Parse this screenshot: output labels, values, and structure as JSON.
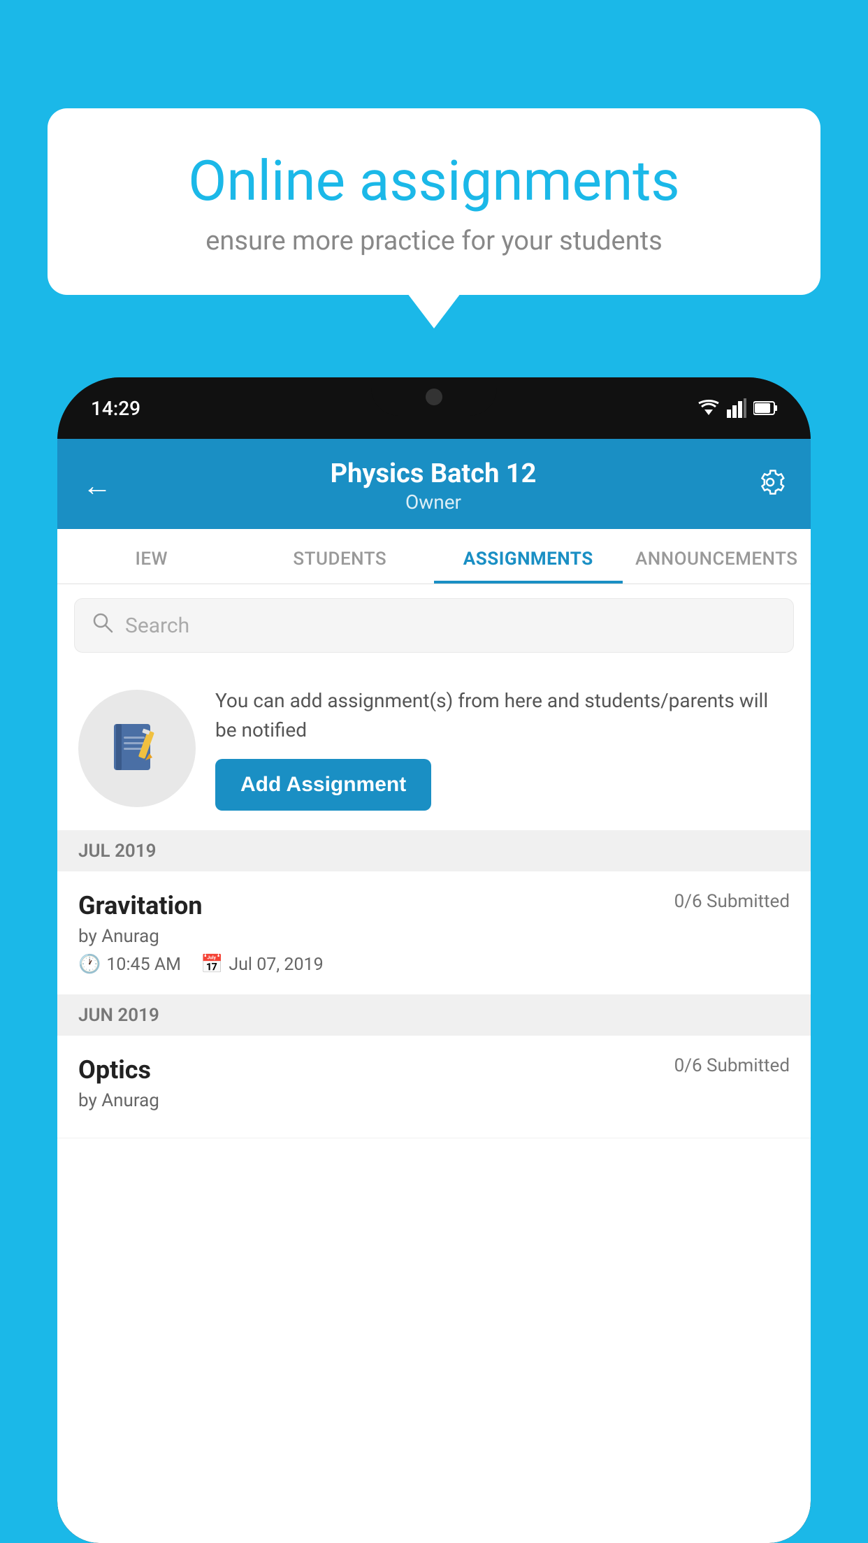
{
  "background_color": "#1bb8e8",
  "speech_bubble": {
    "title": "Online assignments",
    "subtitle": "ensure more practice for your students"
  },
  "phone": {
    "status_bar": {
      "time": "14:29",
      "icons": [
        "wifi",
        "signal",
        "battery"
      ]
    },
    "header": {
      "title": "Physics Batch 12",
      "subtitle": "Owner",
      "back_label": "←",
      "settings_label": "⚙"
    },
    "tabs": [
      {
        "label": "IEW",
        "active": false
      },
      {
        "label": "STUDENTS",
        "active": false
      },
      {
        "label": "ASSIGNMENTS",
        "active": true
      },
      {
        "label": "ANNOUNCEMENTS",
        "active": false
      }
    ],
    "search": {
      "placeholder": "Search"
    },
    "promo": {
      "description": "You can add assignment(s) from here and students/parents will be notified",
      "button_label": "Add Assignment"
    },
    "sections": [
      {
        "month_label": "JUL 2019",
        "assignments": [
          {
            "name": "Gravitation",
            "submitted": "0/6 Submitted",
            "by": "by Anurag",
            "time": "10:45 AM",
            "date": "Jul 07, 2019"
          }
        ]
      },
      {
        "month_label": "JUN 2019",
        "assignments": [
          {
            "name": "Optics",
            "submitted": "0/6 Submitted",
            "by": "by Anurag",
            "time": "",
            "date": ""
          }
        ]
      }
    ]
  }
}
